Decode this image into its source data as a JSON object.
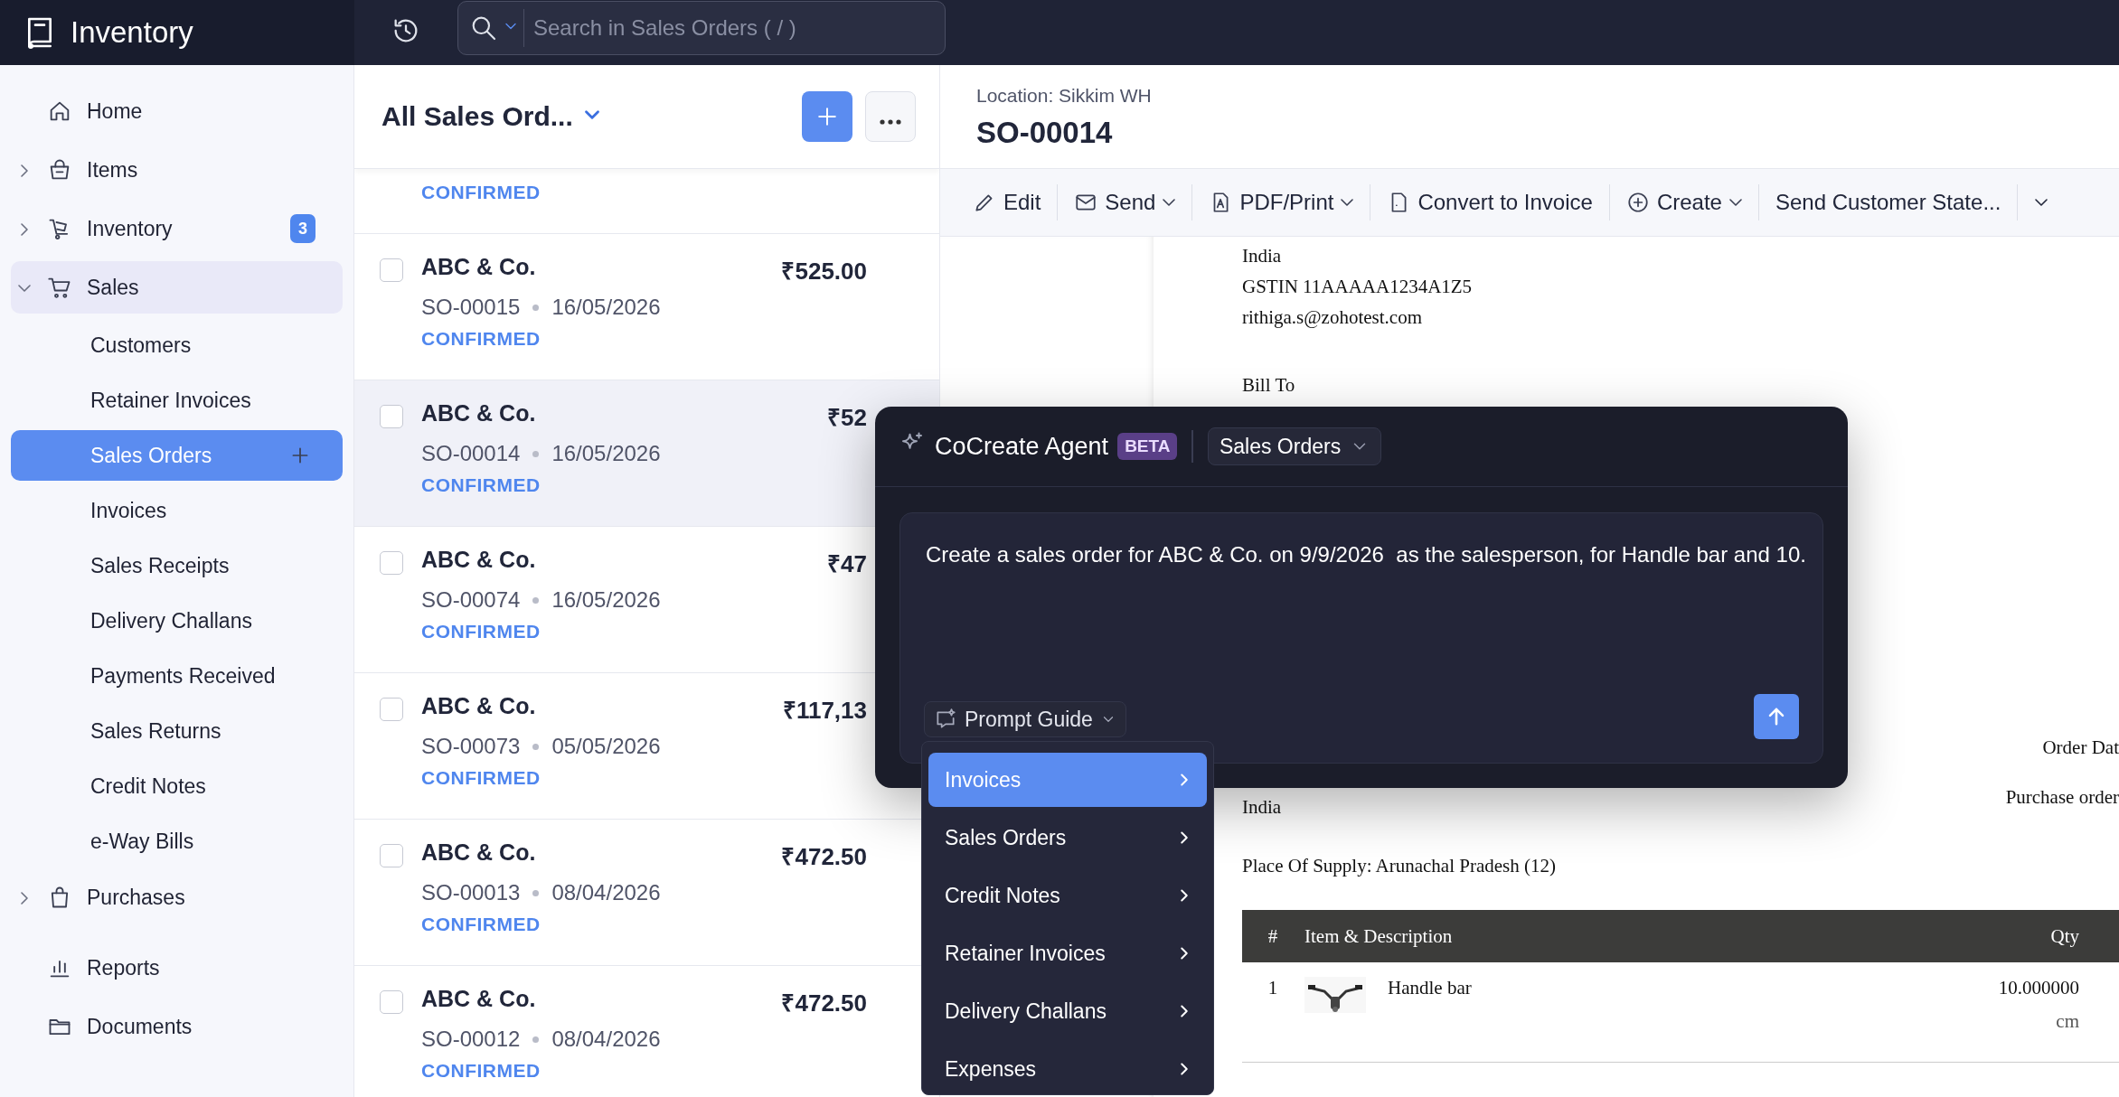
{
  "app": {
    "title": "Inventory"
  },
  "search": {
    "placeholder": "Search in Sales Orders ( / )"
  },
  "sidebar": {
    "items": [
      {
        "label": "Home",
        "selected": false
      },
      {
        "label": "Items",
        "selected": false,
        "expanded": false
      },
      {
        "label": "Inventory",
        "selected": false,
        "expanded": false,
        "badge": "3"
      },
      {
        "label": "Sales",
        "selected": false,
        "expanded": true,
        "children": [
          {
            "label": "Customers",
            "selected": false
          },
          {
            "label": "Retainer Invoices",
            "selected": false
          },
          {
            "label": "Sales Orders",
            "selected": true
          },
          {
            "label": "Invoices",
            "selected": false
          },
          {
            "label": "Sales Receipts",
            "selected": false
          },
          {
            "label": "Delivery Challans",
            "selected": false
          },
          {
            "label": "Payments Received",
            "selected": false
          },
          {
            "label": "Sales Returns",
            "selected": false
          },
          {
            "label": "Credit Notes",
            "selected": false
          },
          {
            "label": "e-Way Bills",
            "selected": false
          }
        ]
      },
      {
        "label": "Purchases",
        "selected": false,
        "expanded": false
      },
      {
        "label": "Reports",
        "selected": false
      },
      {
        "label": "Documents",
        "selected": false
      }
    ]
  },
  "list": {
    "title": "All Sales Ord...",
    "rows": [
      {
        "status": "CONFIRMED",
        "selected": false
      },
      {
        "customer": "ABC & Co.",
        "number": "SO-00015",
        "date": "16/05/2026",
        "amount": "₹525.00",
        "status": "CONFIRMED",
        "selected": false,
        "checked": false
      },
      {
        "customer": "ABC & Co.",
        "number": "SO-00014",
        "date": "16/05/2026",
        "amount": "₹52",
        "status": "CONFIRMED",
        "selected": true,
        "checked": false
      },
      {
        "customer": "ABC & Co.",
        "number": "SO-00074",
        "date": "16/05/2026",
        "amount": "₹47",
        "status": "CONFIRMED",
        "selected": false,
        "checked": false
      },
      {
        "customer": "ABC & Co.",
        "number": "SO-00073",
        "date": "05/05/2026",
        "amount": "₹117,13",
        "status": "CONFIRMED",
        "selected": false,
        "checked": false
      },
      {
        "customer": "ABC & Co.",
        "number": "SO-00013",
        "date": "08/04/2026",
        "amount": "₹472.50",
        "status": "CONFIRMED",
        "selected": false,
        "checked": false
      },
      {
        "customer": "ABC & Co.",
        "number": "SO-00012",
        "date": "08/04/2026",
        "amount": "₹472.50",
        "status": "CONFIRMED",
        "selected": false,
        "checked": false
      }
    ]
  },
  "detail": {
    "location": "Location: Sikkim WH",
    "title": "SO-00014",
    "toolbar": [
      {
        "label": "Edit",
        "dropdown": false
      },
      {
        "label": "Send",
        "dropdown": true
      },
      {
        "label": "PDF/Print",
        "dropdown": true
      },
      {
        "label": "Convert to Invoice",
        "dropdown": false
      },
      {
        "label": "Create",
        "dropdown": true
      },
      {
        "label": "Send Customer State...",
        "dropdown": false
      }
    ],
    "document": {
      "address_lines": [
        "India",
        "GSTIN 11AAAAA1234A1Z5",
        "rithiga.s@zohotest.com"
      ],
      "bill_to": "Bill To",
      "bill_country": "India",
      "order_date_label": "Order Dat",
      "purchase_order_label": "Purchase order",
      "place_of_supply": "Place Of Supply: Arunachal Pradesh (12)",
      "table": {
        "columns": [
          "#",
          "Item & Description",
          "Qty"
        ],
        "rows": [
          {
            "index": "1",
            "item": "Handle bar",
            "qty": "10.000000",
            "unit": "cm"
          }
        ]
      }
    }
  },
  "agent": {
    "title": "CoCreate Agent",
    "badge": "BETA",
    "module": "Sales Orders",
    "prompt": "Create a sales order for ABC & Co. on 9/9/2026  as the salesperson, for Handle bar and 10.",
    "prompt_guide": "Prompt Guide",
    "menu": [
      {
        "label": "Invoices",
        "selected": true
      },
      {
        "label": "Sales Orders",
        "selected": false
      },
      {
        "label": "Credit Notes",
        "selected": false
      },
      {
        "label": "Retainer Invoices",
        "selected": false
      },
      {
        "label": "Delivery Challans",
        "selected": false
      },
      {
        "label": "Expenses",
        "selected": false
      }
    ]
  }
}
